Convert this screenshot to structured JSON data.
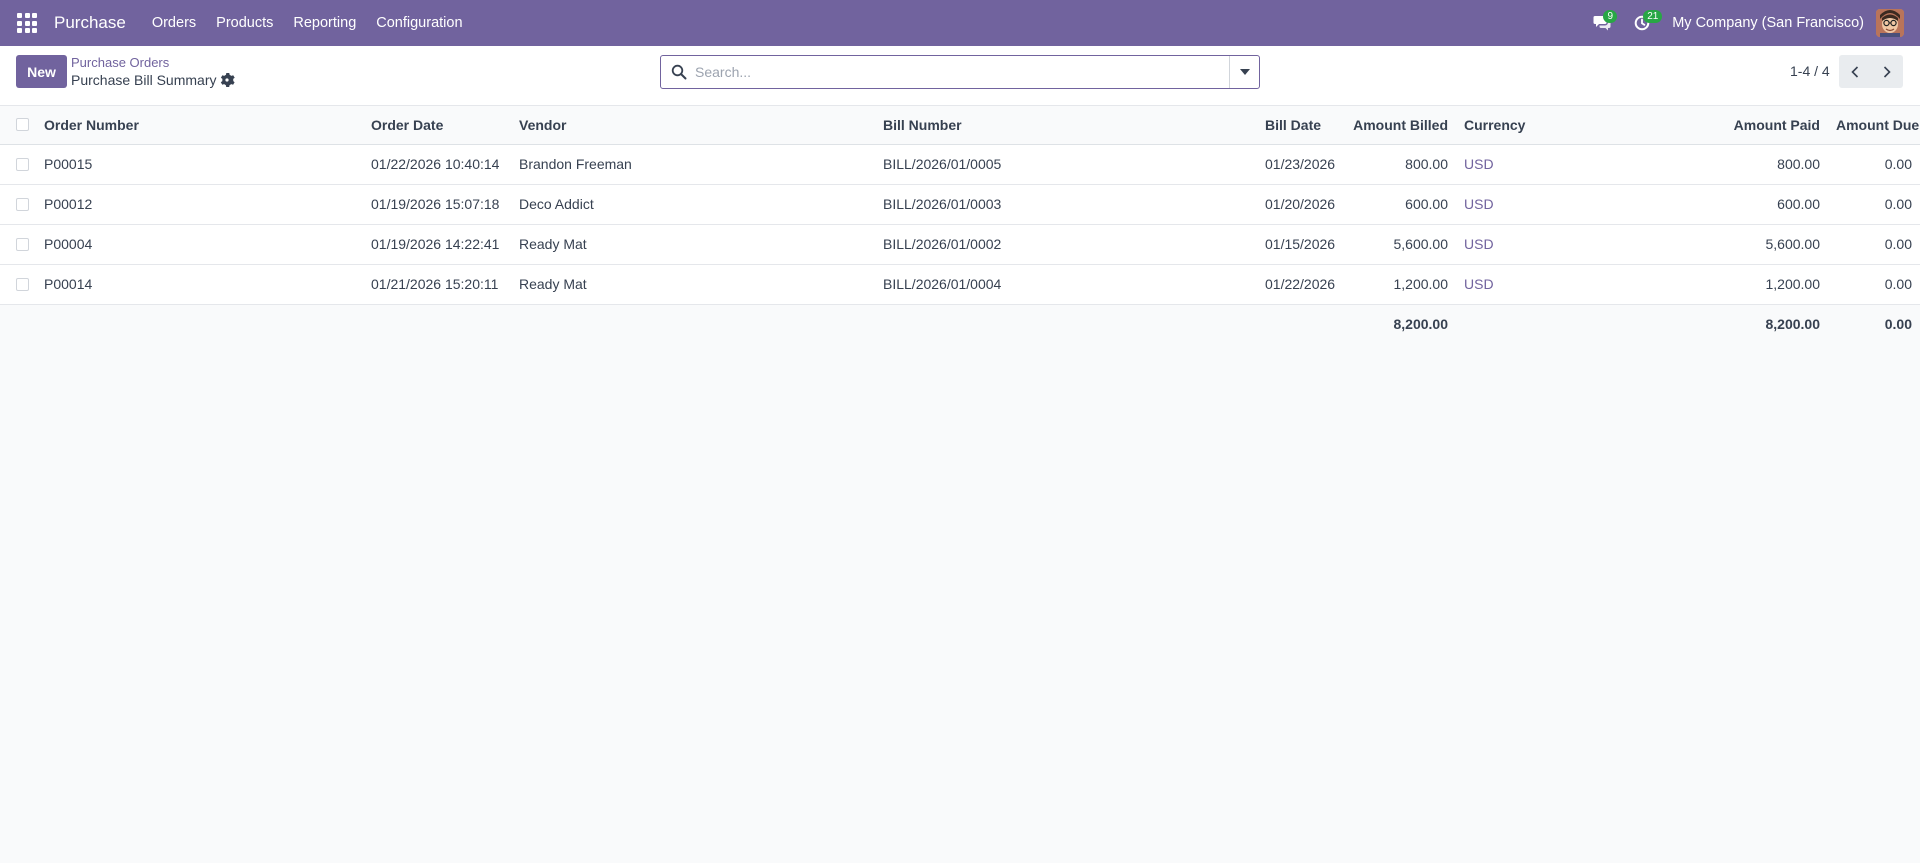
{
  "navbar": {
    "brand": "Purchase",
    "menu": [
      "Orders",
      "Products",
      "Reporting",
      "Configuration"
    ],
    "messages_badge": "9",
    "activities_badge": "21",
    "company": "My Company (San Francisco)",
    "accent_color": "#71639e"
  },
  "control_panel": {
    "new_label": "New",
    "breadcrumb_parent": "Purchase Orders",
    "breadcrumb_current": "Purchase Bill Summary",
    "search_placeholder": "Search...",
    "pager_value": "1-4 / 4"
  },
  "table": {
    "columns": [
      "Order Number",
      "Order Date",
      "Vendor",
      "Bill Number",
      "Bill Date",
      "Amount Billed",
      "Currency",
      "Amount Paid",
      "Amount Due"
    ],
    "rows": [
      [
        "P00015",
        "01/22/2026 10:40:14",
        "Brandon Freeman",
        "BILL/2026/01/0005",
        "01/23/2026",
        "800.00",
        "USD",
        "800.00",
        "0.00"
      ],
      [
        "P00012",
        "01/19/2026 15:07:18",
        "Deco Addict",
        "BILL/2026/01/0003",
        "01/20/2026",
        "600.00",
        "USD",
        "600.00",
        "0.00"
      ],
      [
        "P00004",
        "01/19/2026 14:22:41",
        "Ready Mat",
        "BILL/2026/01/0002",
        "01/15/2026",
        "5,600.00",
        "USD",
        "5,600.00",
        "0.00"
      ],
      [
        "P00014",
        "01/21/2026 15:20:11",
        "Ready Mat",
        "BILL/2026/01/0004",
        "01/22/2026",
        "1,200.00",
        "USD",
        "1,200.00",
        "0.00"
      ]
    ],
    "totals": {
      "amount_billed": "8,200.00",
      "amount_paid": "8,200.00",
      "amount_due": "0.00"
    }
  }
}
